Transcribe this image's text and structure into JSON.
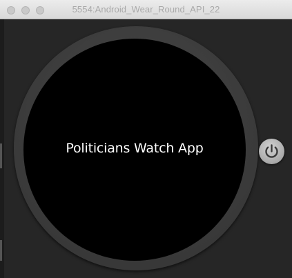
{
  "window": {
    "title": "5554:Android_Wear_Round_API_22"
  },
  "watch": {
    "app_title": "Politicians Watch App"
  },
  "controls": {
    "power_icon": "power-icon"
  }
}
